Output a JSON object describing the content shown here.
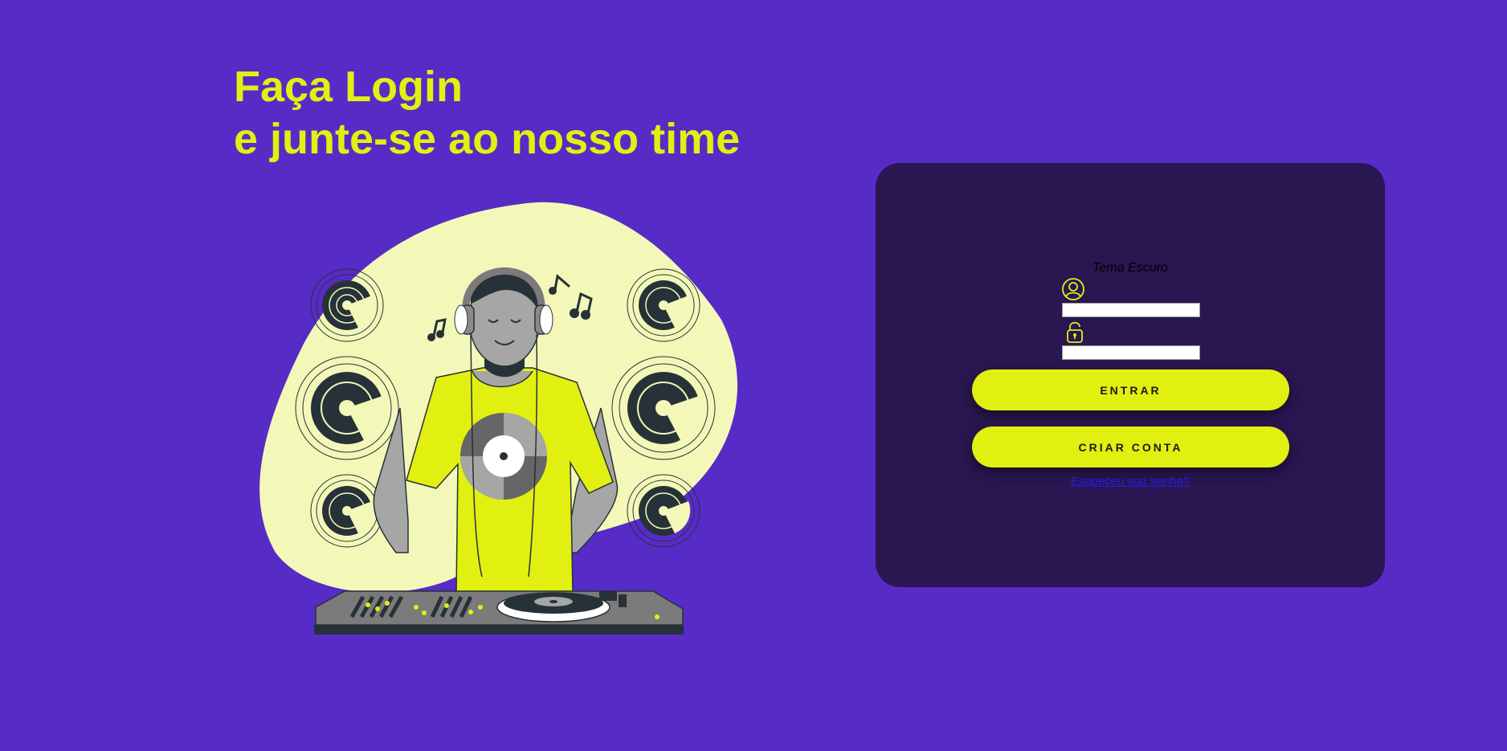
{
  "headline": {
    "line1": "Faça Login",
    "line2": "e junte-se ao nosso time"
  },
  "illustration": {
    "icon": "dj-mixing-illustration"
  },
  "login_card": {
    "theme_toggle_label": "Tema Escuro",
    "username": {
      "icon": "user-icon",
      "value": "",
      "placeholder": ""
    },
    "password": {
      "icon": "lock-icon",
      "value": "",
      "placeholder": ""
    },
    "enter_button_label": "ENTRAR",
    "signup_button_label": "CRIAR CONTA",
    "forgot_password_label": "Esqueceu sua senha?"
  },
  "colors": {
    "background": "#572bc6",
    "accent": "#e1f010",
    "card": "#2a1650",
    "blob": "#f3f7b8",
    "ink": "#263238"
  }
}
